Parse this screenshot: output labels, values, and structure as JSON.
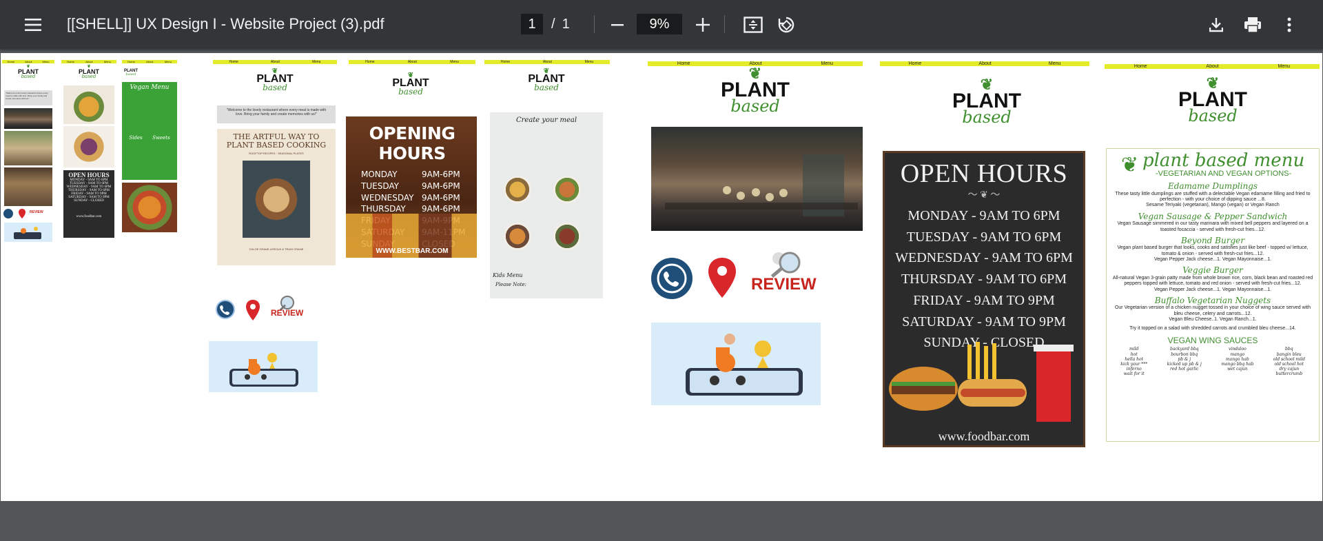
{
  "toolbar": {
    "title": "[[SHELL]] UX Design I - Website Project (3).pdf",
    "page_current": "1",
    "page_separator": "/",
    "page_total": "1",
    "zoom": "9%",
    "icons": {
      "menu": "hamburger-menu-icon",
      "zoom_out": "minus-icon",
      "zoom_in": "plus-icon",
      "fit": "fit-to-page-icon",
      "rotate": "rotate-icon",
      "download": "download-icon",
      "print": "print-icon",
      "more": "more-vertical-icon"
    }
  },
  "nav": {
    "home": "Home",
    "about": "About",
    "menu": "Menu"
  },
  "logo": {
    "plant": "PLANT",
    "based": "based"
  },
  "thumb_text": {
    "welcome": "\"Welcome to the lovely restaurant where every meal is made with love. Bring your family and create memories with us!\"",
    "artful": "THE ARTFUL WAY TO PLANT BASED COOKING",
    "artful_sub": "ROOFTOP RECIPES · SEASONAL PLATES",
    "artful_auth": "CHLOE CRANE-LEROUX & TRUDI CRANE",
    "opening_hours": "OPENING HOURS",
    "bestbar": "WWW.BESTBAR.COM",
    "create_meal": "Create your meal",
    "kids_menu": "Kids Menu",
    "please_note": "Please Note:",
    "vegan_menu": "Vegan Menu",
    "sides": "Sides",
    "sweets": "Sweets",
    "review": "REVIEW"
  },
  "opening_hours_small": [
    {
      "day": "MONDAY",
      "time": "9AM-6PM"
    },
    {
      "day": "TUESDAY",
      "time": "9AM-6PM"
    },
    {
      "day": "WEDNESDAY",
      "time": "9AM-6PM"
    },
    {
      "day": "THURSDAY",
      "time": "9AM-6PM"
    },
    {
      "day": "FRIDAY",
      "time": "9AM-9PM"
    },
    {
      "day": "SATURDAY",
      "time": "9AM-11PM"
    },
    {
      "day": "SUNDAY",
      "time": "CLOSED"
    }
  ],
  "open_hours_large": {
    "title": "OPEN HOURS",
    "rows": [
      "MONDAY - 9AM TO 6PM",
      "TUESDAY - 9AM TO 6PM",
      "WEDNESDAY - 9AM TO 6PM",
      "THURSDAY - 9AM TO 6PM",
      "FRIDAY - 9AM TO 9PM",
      "SATURDAY - 9AM TO 9PM",
      "SUNDAY - CLOSED"
    ],
    "footer": "www.foodbar.com"
  },
  "open_hours_small_rows": [
    "MONDAY - 9AM TO 6PM",
    "TUESDAY - 9AM TO 6PM",
    "WEDNESDAY - 9AM TO 6PM",
    "THURSDAY - 9AM TO 6PM",
    "FRIDAY - 9AM TO 9PM",
    "SATURDAY - 9AM TO 9PM",
    "SUNDAY - CLOSED"
  ],
  "plant_menu": {
    "title": "plant based menu",
    "subtitle": "-VEGETARIAN AND VEGAN OPTIONS-",
    "items": [
      {
        "name": "Edamame Dumplings",
        "desc": "These tasty little dumplings are stuffed with a delectable Vegan edamame filling and fried to perfection - with your choice of dipping sauce ...8.",
        "extra": "Sesame Teriyaki (vegetarian), Mango (vegan) or Vegan Ranch"
      },
      {
        "name": "Vegan Sausage & Pepper Sandwich",
        "desc": "Vegan Sausage simmered in our tasty marinara with mixed bell peppers and layered on a toasted focaccia - served with fresh-cut fries...12.",
        "extra": ""
      },
      {
        "name": "Beyond Burger",
        "desc": "Vegan plant based burger that looks, cooks and satisfies just like beef - topped w/ lettuce, tomato & onion - served with fresh-cut fries...12.",
        "extra": "Vegan Pepper Jack cheese...1.   Vegan Mayonnaise...1."
      },
      {
        "name": "Veggie Burger",
        "desc": "All-natural Vegan 3-grain patty made from whole brown rice, corn, black bean and roasted red peppers topped with lettuce, tomato and red onion - served with fresh-cut fries...12.",
        "extra": "Vegan Pepper Jack cheese...1.   Vegan Mayonnaise...1."
      },
      {
        "name": "Buffalo Vegetarian Nuggets",
        "desc": "Our Vegetarian version of a chicken nugget tossed in your choice of wing sauce served with bleu cheese, celery and carrots...12.",
        "extra": "Vegan Bleu Cheese..1.   Vegan Ranch...1."
      },
      {
        "name": "",
        "desc": "Try it topped on a salad with shredded carrots and crumbled bleu cheese...14.",
        "extra": ""
      }
    ],
    "sauces_title": "VEGAN WING SAUCES",
    "sauces": [
      [
        "mild",
        "hot",
        "hella hot",
        "kick your ***",
        "inferno",
        "wait for it"
      ],
      [
        "backyard bbq",
        "bourbon bbq",
        "pb & j",
        "kicked up pb & j",
        "red hot garlic"
      ],
      [
        "vindaloo",
        "mango",
        "mango hab",
        "mango bbq hab",
        "wet cajun"
      ],
      [
        "bbq",
        "bangin bleu",
        "old school mild",
        "old school hot",
        "dry cajun",
        "buttercrumb"
      ]
    ]
  }
}
